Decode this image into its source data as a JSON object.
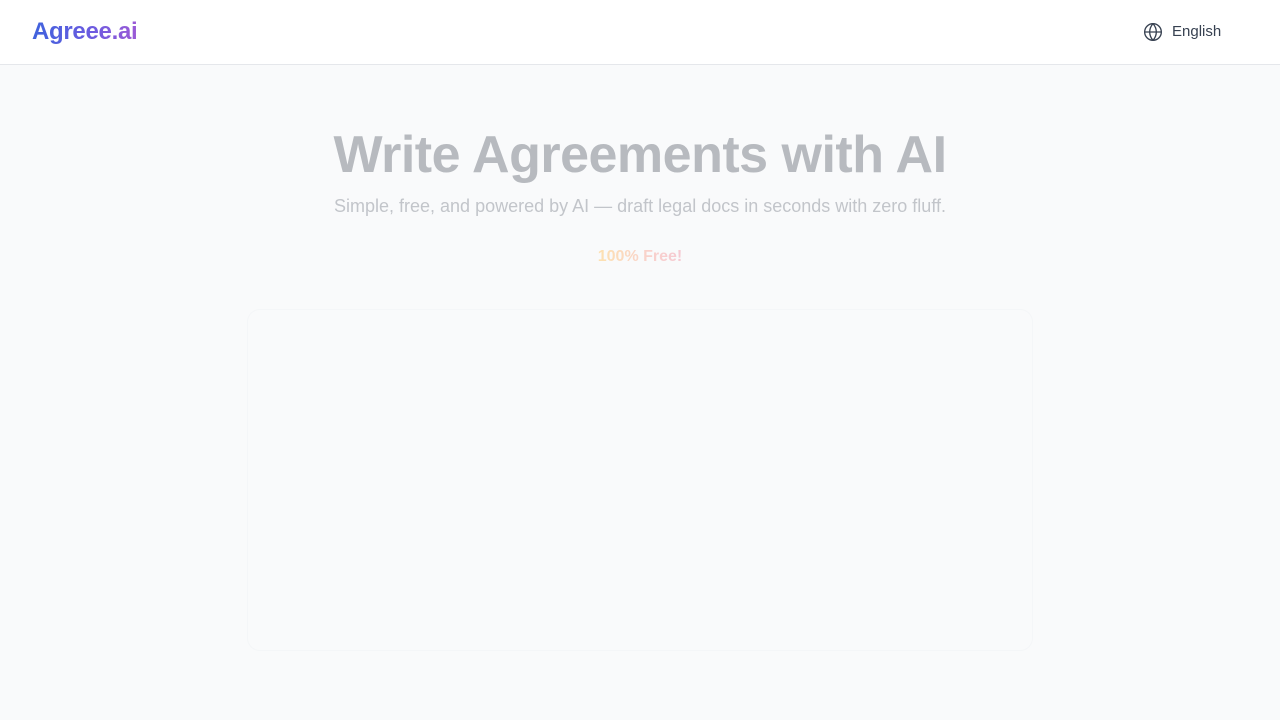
{
  "header": {
    "brand": "Agreee.ai",
    "language_label": "English"
  },
  "hero": {
    "title": "Write Agreements with AI",
    "subtitle": "Simple, free, and powered by AI — draft legal docs in seconds with zero fluff.",
    "badge": "100% Free!"
  },
  "icons": {
    "language": "globe-icon"
  },
  "colors": {
    "brand_gradient_start": "#3f63dd",
    "brand_gradient_end": "#9b5ad6",
    "page_background": "#f9fafb",
    "header_background": "#ffffff"
  }
}
